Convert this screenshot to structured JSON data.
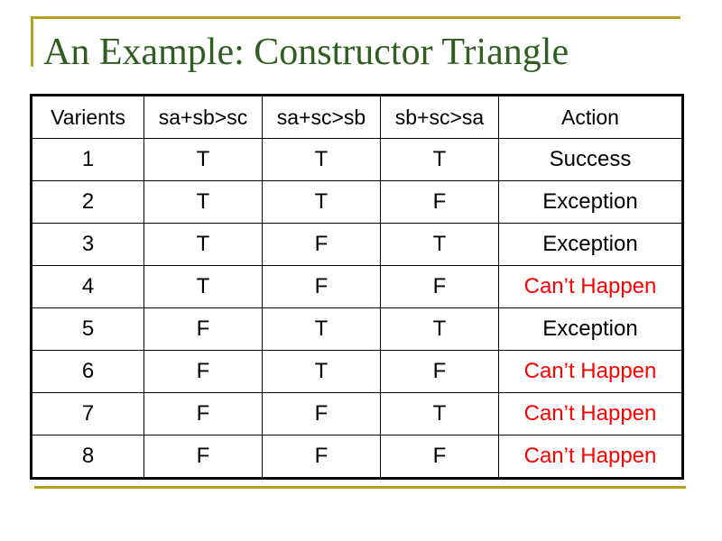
{
  "slide": {
    "title": "An Example: Constructor Triangle",
    "accent_color": "#b5a21c",
    "title_color": "#2f5e20",
    "warning_color": "#ff0000"
  },
  "table": {
    "headers": [
      "Varients",
      "sa+sb>sc",
      "sa+sc>sb",
      "sb+sc>sa",
      "Action"
    ],
    "rows": [
      {
        "variant": "1",
        "c1": "T",
        "c2": "T",
        "c3": "T",
        "action": "Success",
        "warn": false
      },
      {
        "variant": "2",
        "c1": "T",
        "c2": "T",
        "c3": "F",
        "action": "Exception",
        "warn": false
      },
      {
        "variant": "3",
        "c1": "T",
        "c2": "F",
        "c3": "T",
        "action": "Exception",
        "warn": false
      },
      {
        "variant": "4",
        "c1": "T",
        "c2": "F",
        "c3": "F",
        "action": "Can’t Happen",
        "warn": true
      },
      {
        "variant": "5",
        "c1": "F",
        "c2": "T",
        "c3": "T",
        "action": "Exception",
        "warn": false
      },
      {
        "variant": "6",
        "c1": "F",
        "c2": "T",
        "c3": "F",
        "action": "Can’t Happen",
        "warn": true
      },
      {
        "variant": "7",
        "c1": "F",
        "c2": "F",
        "c3": "T",
        "action": "Can’t Happen",
        "warn": true
      },
      {
        "variant": "8",
        "c1": "F",
        "c2": "F",
        "c3": "F",
        "action": "Can’t Happen",
        "warn": true
      }
    ]
  }
}
